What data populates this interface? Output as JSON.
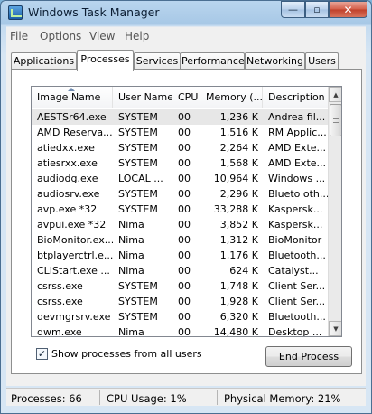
{
  "window": {
    "title": "Windows Task Manager",
    "minimize_glyph": "—",
    "maximize_glyph": "▫",
    "close_glyph": "✕"
  },
  "menu": [
    "File",
    "Options",
    "View",
    "Help"
  ],
  "tabs": [
    {
      "label": "Applications",
      "active": false
    },
    {
      "label": "Processes",
      "active": true
    },
    {
      "label": "Services",
      "active": false
    },
    {
      "label": "Performance",
      "active": false
    },
    {
      "label": "Networking",
      "active": false
    },
    {
      "label": "Users",
      "active": false
    }
  ],
  "processes": {
    "columns": [
      "Image Name",
      "User Name",
      "CPU",
      "Memory (...",
      "Description"
    ],
    "sorted_column": "Image Name",
    "sort_direction": "ascending",
    "selected_row": 0,
    "rows": [
      [
        "AESTSr64.exe",
        "SYSTEM",
        "00",
        "1,236 K",
        "Andrea fil..."
      ],
      [
        "AMD Reserva...",
        "SYSTEM",
        "00",
        "1,516 K",
        "RM Applic..."
      ],
      [
        "atiedxx.exe",
        "SYSTEM",
        "00",
        "2,264 K",
        "AMD Exte..."
      ],
      [
        "atiesrxx.exe",
        "SYSTEM",
        "00",
        "1,568 K",
        "AMD Exte..."
      ],
      [
        "audiodg.exe",
        "LOCAL ...",
        "00",
        "10,964 K",
        "Windows ..."
      ],
      [
        "audiosrv.exe",
        "SYSTEM",
        "00",
        "2,296 K",
        "Blueto oth..."
      ],
      [
        "avp.exe *32",
        "SYSTEM",
        "00",
        "33,288 K",
        "Kaspersk..."
      ],
      [
        "avpui.exe *32",
        "Nima",
        "00",
        "3,852 K",
        "Kaspersk..."
      ],
      [
        "BioMonitor.ex...",
        "Nima",
        "00",
        "1,312 K",
        "BioMonitor"
      ],
      [
        "btplayerctrl.e...",
        "Nima",
        "00",
        "1,176 K",
        "Bluetooth..."
      ],
      [
        "CLIStart.exe ...",
        "Nima",
        "00",
        "624 K",
        "Catalyst..."
      ],
      [
        "csrss.exe",
        "SYSTEM",
        "00",
        "1,748 K",
        "Client Ser..."
      ],
      [
        "csrss.exe",
        "SYSTEM",
        "00",
        "1,928 K",
        "Client Ser..."
      ],
      [
        "devmgrsrv.exe",
        "SYSTEM",
        "00",
        "6,320 K",
        "Bluetooth..."
      ],
      [
        "dwm.exe",
        "Nima",
        "00",
        "14,480 K",
        "Desktop ..."
      ]
    ]
  },
  "scrollbar": {
    "up_glyph": "▲",
    "down_glyph": "▼"
  },
  "show_all_users": {
    "label": "Show processes from all users",
    "checked": true,
    "check_glyph": "✓"
  },
  "end_process_label": "End Process",
  "status": {
    "processes": "Processes: 66",
    "cpu": "CPU Usage: 1%",
    "memory": "Physical Memory: 21%"
  }
}
